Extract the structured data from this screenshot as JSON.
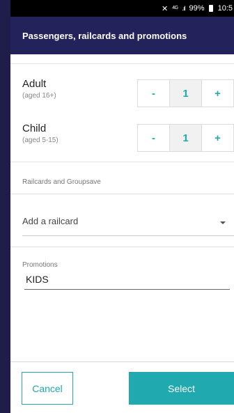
{
  "status_bar": {
    "network": "4G",
    "battery": "99%",
    "time": "10:5"
  },
  "dialog": {
    "title": "Passengers, railcards and promotions"
  },
  "passengers": [
    {
      "label": "Adult",
      "age": "(aged 16+)",
      "count": "1",
      "minus": "-",
      "plus": "+"
    },
    {
      "label": "Child",
      "age": "(aged 5-15)",
      "count": "1",
      "minus": "-",
      "plus": "+"
    }
  ],
  "railcards": {
    "section_title": "Railcards and Groupsave",
    "select_placeholder": "Add a railcard"
  },
  "promotions": {
    "section_title": "Promotions",
    "code_value": "KIDS"
  },
  "footer": {
    "cancel_label": "Cancel",
    "select_label": "Select"
  },
  "colors": {
    "accent": "#21a9b0",
    "header_bg": "#24225a",
    "backdrop": "#1f1d4a"
  }
}
